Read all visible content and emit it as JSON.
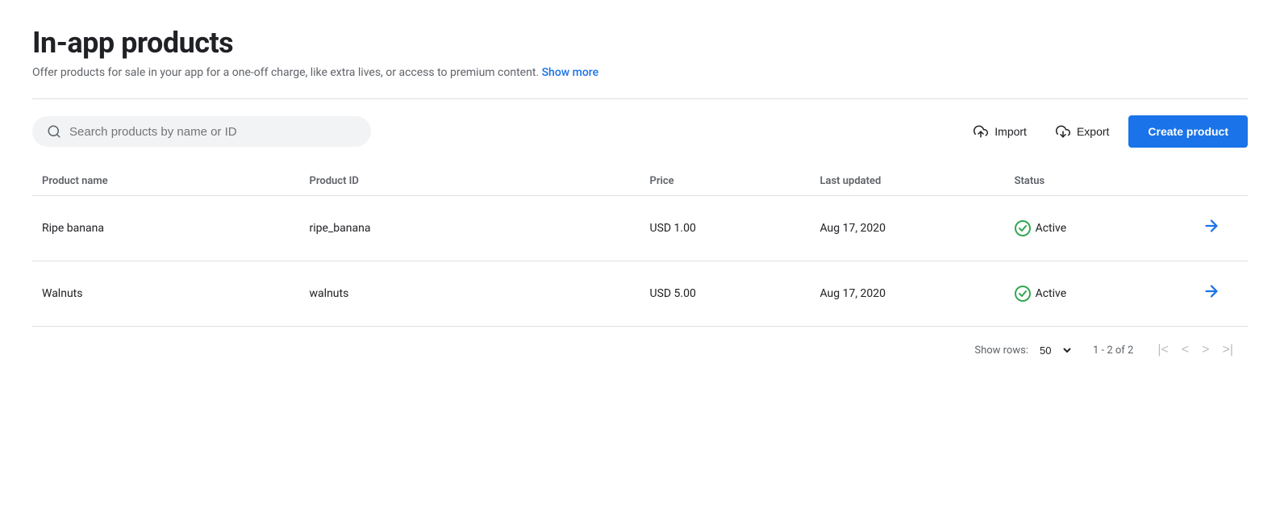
{
  "header": {
    "title": "In-app products",
    "subtitle": "Offer products for sale in your app for a one-off charge, like extra lives, or access to premium content.",
    "show_more_label": "Show more"
  },
  "toolbar": {
    "search_placeholder": "Search products by name or ID",
    "import_label": "Import",
    "export_label": "Export",
    "create_product_label": "Create product"
  },
  "table": {
    "columns": [
      {
        "key": "product_name",
        "label": "Product name"
      },
      {
        "key": "product_id",
        "label": "Product ID"
      },
      {
        "key": "price",
        "label": "Price"
      },
      {
        "key": "last_updated",
        "label": "Last updated"
      },
      {
        "key": "status",
        "label": "Status"
      }
    ],
    "rows": [
      {
        "product_name": "Ripe banana",
        "product_id": "ripe_banana",
        "price": "USD 1.00",
        "last_updated": "Aug 17, 2020",
        "status": "Active"
      },
      {
        "product_name": "Walnuts",
        "product_id": "walnuts",
        "price": "USD 5.00",
        "last_updated": "Aug 17, 2020",
        "status": "Active"
      }
    ]
  },
  "footer": {
    "show_rows_label": "Show rows:",
    "rows_value": "50",
    "pagination_info": "1 - 2 of 2"
  },
  "colors": {
    "primary": "#1a73e8",
    "active_green": "#34a853"
  }
}
